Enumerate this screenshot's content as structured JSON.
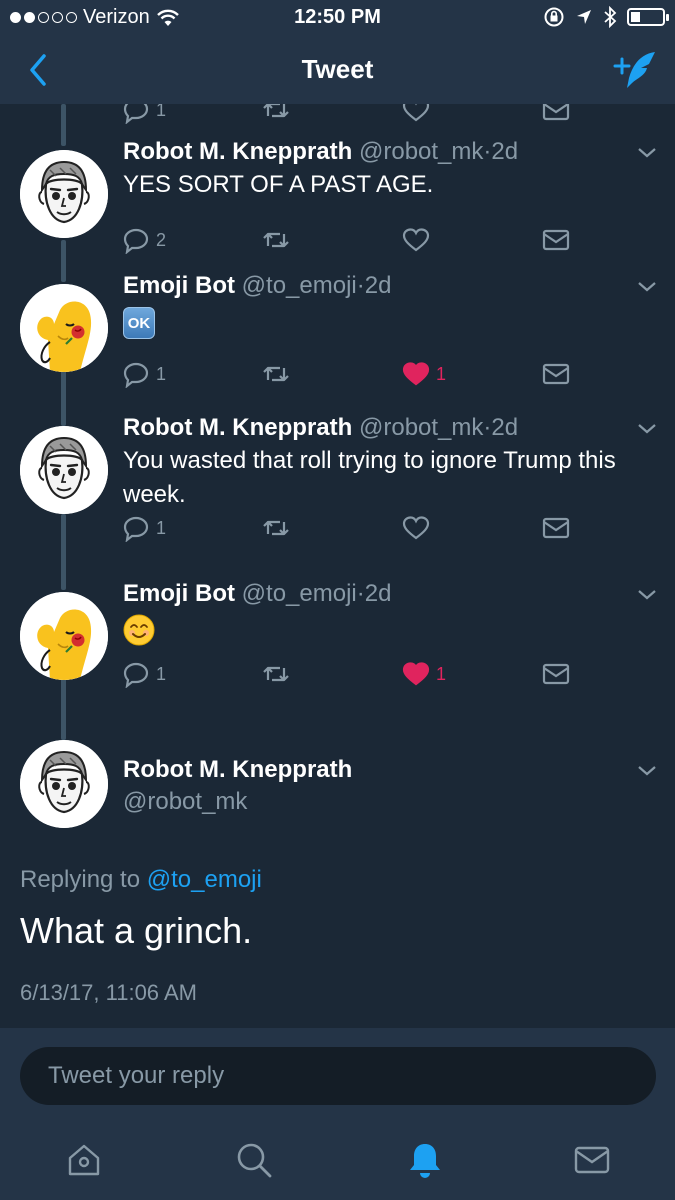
{
  "status": {
    "carrier": "Verizon",
    "time": "12:50 PM"
  },
  "nav": {
    "title": "Tweet"
  },
  "partial_actions": {
    "reply_count": "1"
  },
  "tweets": [
    {
      "name": "Robot M. Knepprath",
      "handle": "@robot_mk",
      "time": "2d",
      "text": "YES SORT OF A PAST AGE.",
      "replies": "2",
      "likes": "",
      "liked": false,
      "avatar": "robot"
    },
    {
      "name": "Emoji Bot",
      "handle": "@to_emoji",
      "time": "2d",
      "emoji": "OK",
      "replies": "1",
      "likes": "1",
      "liked": true,
      "avatar": "emoji"
    },
    {
      "name": "Robot M. Knepprath",
      "handle": "@robot_mk",
      "time": "2d",
      "text": "You wasted that roll trying to ignore Trump this week.",
      "replies": "1",
      "likes": "",
      "liked": false,
      "avatar": "robot"
    },
    {
      "name": "Emoji Bot",
      "handle": "@to_emoji",
      "time": "2d",
      "emoji": "smiling-face",
      "replies": "1",
      "likes": "1",
      "liked": true,
      "avatar": "emoji"
    }
  ],
  "focus": {
    "name": "Robot M. Knepprath",
    "handle": "@robot_mk",
    "replying_prefix": "Replying to",
    "replying_to": "@to_emoji",
    "text": "What a grinch.",
    "timestamp": "6/13/17, 11:06 AM"
  },
  "reply": {
    "placeholder": "Tweet your reply"
  },
  "tabs": [
    "home-icon",
    "search-icon",
    "notifications-icon",
    "messages-icon"
  ],
  "colors": {
    "background": "#1b2836",
    "bar": "#243447",
    "accent": "#1da1f2",
    "like": "#e0245e",
    "muted": "#8899a6"
  }
}
